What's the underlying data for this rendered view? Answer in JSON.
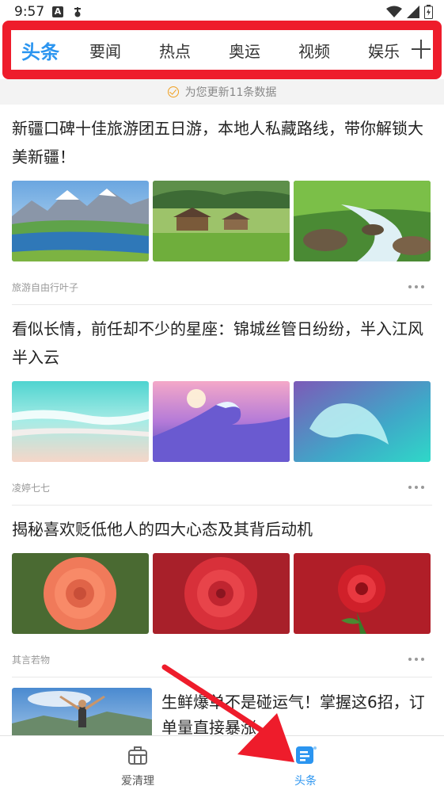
{
  "status_bar": {
    "time": "9:57",
    "left_icons": [
      "notification-a-icon",
      "vpn-key-icon"
    ],
    "right_icons": [
      "wifi-icon",
      "signal-icon",
      "battery-icon"
    ]
  },
  "tabs": [
    {
      "label": "头条",
      "active": true
    },
    {
      "label": "要闻",
      "active": false
    },
    {
      "label": "热点",
      "active": false
    },
    {
      "label": "奥运",
      "active": false
    },
    {
      "label": "视频",
      "active": false
    },
    {
      "label": "娱乐",
      "active": false
    }
  ],
  "update_notice": "为您更新11条数据",
  "articles": [
    {
      "title": "新疆口碑十佳旅游团五日游，本地人私藏路线，带你解锁大美新疆！",
      "source": "旅游自由行叶子",
      "images": [
        "mountain-lake-image",
        "village-meadow-image",
        "mountain-stream-image"
      ]
    },
    {
      "title": "看似长情，前任却不少的星座：锦城丝管日纷纷，半入江风半入云",
      "source": "凌婷七七",
      "images": [
        "beach-waves-image",
        "purple-wave-image",
        "turquoise-wave-image"
      ]
    },
    {
      "title": "揭秘喜欢贬低他人的四大心态及其背后动机",
      "source": "其言若物",
      "images": [
        "coral-rose-image",
        "red-rose-image",
        "red-rose-dew-image"
      ]
    },
    {
      "title": "生鲜爆单不是碰运气！掌握这6招，订单量直接暴涨",
      "source": "",
      "images": [
        "man-on-mountain-image"
      ]
    }
  ],
  "bottom_nav": [
    {
      "label": "爱清理",
      "active": false,
      "icon": "briefcase-clean-icon"
    },
    {
      "label": "头条",
      "active": true,
      "icon": "news-icon"
    }
  ],
  "colors": {
    "accent": "#2b95f0",
    "highlight_red": "#ee1c2b",
    "text": "#222222",
    "muted": "#999999"
  }
}
